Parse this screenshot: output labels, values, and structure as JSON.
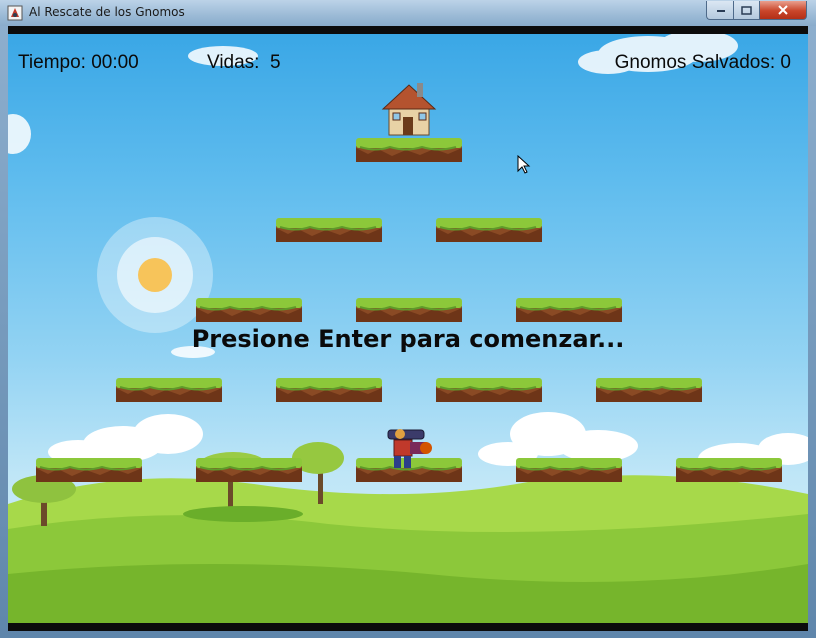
{
  "window": {
    "title": "Al Rescate de los Gnomos"
  },
  "hud": {
    "time_label": "Tiempo: 00:00",
    "lives_label": "Vidas:  5",
    "gnomes_label": "Gnomos Salvados: 0"
  },
  "prompt": "Presione Enter para comenzar...",
  "icons": [
    "app-icon",
    "minimize-icon",
    "maximize-icon",
    "close-icon",
    "mouse-cursor-icon"
  ],
  "colors": {
    "sky_top": "#3aa7e6",
    "grass": "#8cc83a",
    "platform_dirt": "#8a4a24"
  }
}
